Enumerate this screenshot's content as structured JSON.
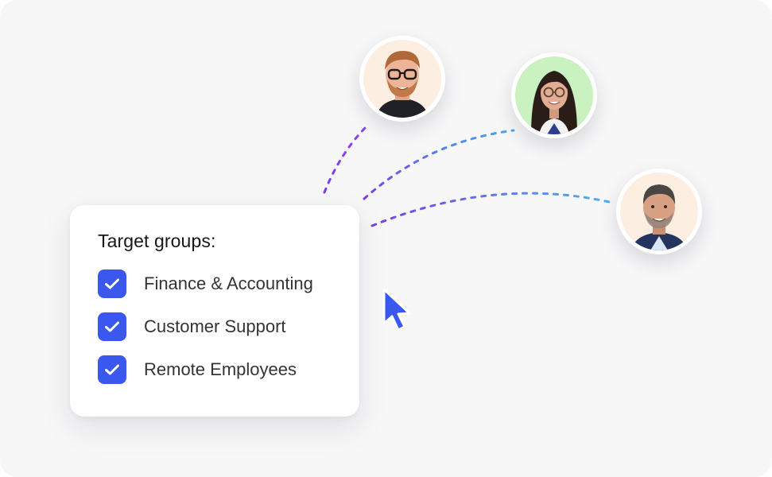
{
  "card": {
    "title": "Target groups:",
    "groups": [
      {
        "label": "Finance & Accounting",
        "checked": true
      },
      {
        "label": "Customer Support",
        "checked": true
      },
      {
        "label": "Remote Employees",
        "checked": true
      }
    ]
  },
  "avatars": [
    {
      "icon": "man-glasses-avatar",
      "bg_color": "#fdeee2"
    },
    {
      "icon": "woman-glasses-avatar",
      "bg_color": "#c9f2c0"
    },
    {
      "icon": "man-beard-avatar",
      "bg_color": "#fdeee2"
    }
  ],
  "colors": {
    "accent": "#3a57ef",
    "connector_purple": "#7a3ee6",
    "connector_blue": "#4aa6ec",
    "cursor": "#3a57ef"
  },
  "cursor_icon": "mouse-pointer-icon"
}
